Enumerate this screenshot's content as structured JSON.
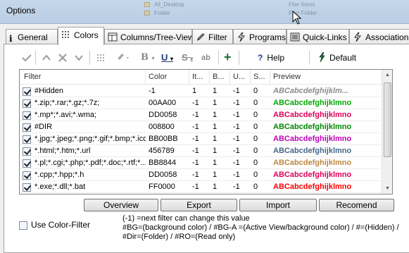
{
  "window": {
    "title": "Options"
  },
  "background_rows": [
    "All_Desktop",
    "Filer Items",
    "Folder",
    "Filer Folder"
  ],
  "tabs": [
    {
      "label": "General",
      "icon": "info-icon"
    },
    {
      "label": "Colors",
      "icon": "colors-grid-icon",
      "active": true
    },
    {
      "label": "Columns/Tree-View",
      "icon": "columns-icon"
    },
    {
      "label": "Filter",
      "icon": "filter-brush-icon"
    },
    {
      "label": "Programs",
      "icon": "lightning-icon"
    },
    {
      "label": "Quick-Links",
      "icon": "quicklinks-icon"
    },
    {
      "label": "Association",
      "icon": "lightning-icon"
    }
  ],
  "toolbar": {
    "help_label": "Help",
    "default_label": "Default",
    "bold_glyph": "B",
    "underline_glyph": "U",
    "strike_glyph": "S",
    "ab_glyph": "ab",
    "add_glyph": "+"
  },
  "grid": {
    "columns": [
      "Filter",
      "Color",
      "It...",
      "B...",
      "U...",
      "S...",
      "Preview"
    ],
    "rows": [
      {
        "filter": "#Hidden",
        "color": "-1",
        "it": "1",
        "b": "1",
        "u": "-1",
        "s": "0",
        "preview": "ABCabcdefghijklm...",
        "preview_color": "#8c8c8c",
        "italic": true
      },
      {
        "filter": "*.zip;*.rar;*.gz;*.7z;",
        "color": "00AA00",
        "it": "-1",
        "b": "1",
        "u": "-1",
        "s": "0",
        "preview": "ABCabcdefghijklmno",
        "preview_color": "#00aa00",
        "italic": false
      },
      {
        "filter": "*.mp*;*.avi;*.wma;",
        "color": "DD0058",
        "it": "-1",
        "b": "1",
        "u": "-1",
        "s": "0",
        "preview": "ABCabcdefghijklmno",
        "preview_color": "#dd0058",
        "italic": false
      },
      {
        "filter": "#DIR",
        "color": "008800",
        "it": "-1",
        "b": "1",
        "u": "-1",
        "s": "0",
        "preview": "ABCabcdefghijklmno",
        "preview_color": "#008800",
        "italic": false
      },
      {
        "filter": "*.jpg;*.jpeg;*.png;*.gif;*.bmp;*.ico",
        "color": "BB00BB",
        "it": "-1",
        "b": "1",
        "u": "-1",
        "s": "0",
        "preview": "ABCabcdefghijklmno",
        "preview_color": "#bb00bb",
        "italic": false
      },
      {
        "filter": "*.html;*.htm;*.url",
        "color": "456789",
        "it": "-1",
        "b": "1",
        "u": "-1",
        "s": "0",
        "preview": "ABCabcdefghijklmno",
        "preview_color": "#456789",
        "italic": false
      },
      {
        "filter": "*.pl;*.cgi;*.php;*.pdf;*.doc;*.rtf;*...",
        "color": "BB8844",
        "it": "-1",
        "b": "1",
        "u": "-1",
        "s": "0",
        "preview": "ABCabcdefghijklmno",
        "preview_color": "#bb8844",
        "italic": false
      },
      {
        "filter": "*.cpp;*.hpp;*.h",
        "color": "DD0058",
        "it": "-1",
        "b": "1",
        "u": "-1",
        "s": "0",
        "preview": "ABCabcdefghijklmno",
        "preview_color": "#dd0058",
        "italic": false
      },
      {
        "filter": "*.exe;*.dll;*.bat",
        "color": "FF0000",
        "it": "-1",
        "b": "1",
        "u": "-1",
        "s": "0",
        "preview": "ABCabcdefghijklmno",
        "preview_color": "#ff0000",
        "italic": false
      }
    ]
  },
  "buttons": {
    "overview": "Overview",
    "export": "Export",
    "import": "Import",
    "recomend": "Recomend"
  },
  "use_color_filter": {
    "label": "Use Color-Filter",
    "checked": false
  },
  "hint": [
    "(-1) =next filter can change this value",
    "#BG=(background color) / #BG-A =(Active View/background color) / #=(Hidden) /",
    "#Dir=(Folder) / #RO=(Read only)"
  ]
}
